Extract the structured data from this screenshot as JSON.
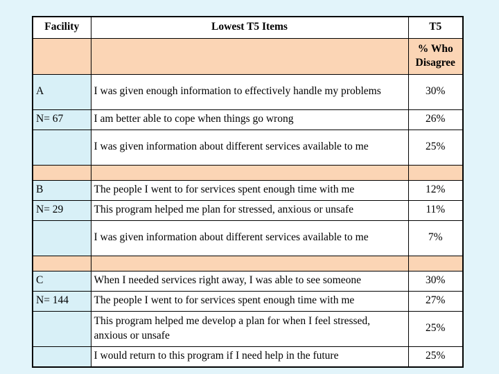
{
  "slide": {
    "background_color": "#e2f4fa"
  },
  "colors": {
    "header_fill": "#ffffff",
    "subheader_fill": "#fbd5b5",
    "spacer_fill": "#fbd5b5",
    "facility_fill": "#d8f0f7",
    "item_fill": "#ffffff",
    "border": "#000000"
  },
  "table": {
    "headers": {
      "facility": "Facility",
      "items": "Lowest T5 Items",
      "pct_top": "T5",
      "pct_sub_line1": "% Who",
      "pct_sub_line2": "Disagree"
    },
    "sections": [
      {
        "facility_label": "A",
        "n_label": "N= 67",
        "rows": [
          {
            "item": "I was given enough information to effectively handle my problems",
            "pct": "30%",
            "tall": true
          },
          {
            "item": "I am better able to cope when things go wrong",
            "pct": "26%",
            "tall": false
          },
          {
            "item": "I was given information about different services available to me",
            "pct": "25%",
            "tall": true
          }
        ]
      },
      {
        "facility_label": "B",
        "n_label": "N= 29",
        "rows": [
          {
            "item": "The people I went to for services spent enough time with me",
            "pct": "12%",
            "tall": false
          },
          {
            "item": "This program helped me plan for stressed, anxious or unsafe",
            "pct": "11%",
            "tall": false
          },
          {
            "item": "I was given information about different services available to me",
            "pct": "7%",
            "tall": true
          }
        ]
      },
      {
        "facility_label": "C",
        "n_label": "N= 144",
        "rows": [
          {
            "item": "When I needed services right away, I was able to see someone",
            "pct": "30%",
            "tall": false
          },
          {
            "item": "The people I went to for services spent enough time with me",
            "pct": "27%",
            "tall": false
          },
          {
            "item": "This program helped me develop a plan for when I feel stressed, anxious or unsafe",
            "pct": "25%",
            "tall": true
          },
          {
            "item": "I would return to this program if I need help in the future",
            "pct": "25%",
            "tall": false
          }
        ]
      }
    ]
  }
}
